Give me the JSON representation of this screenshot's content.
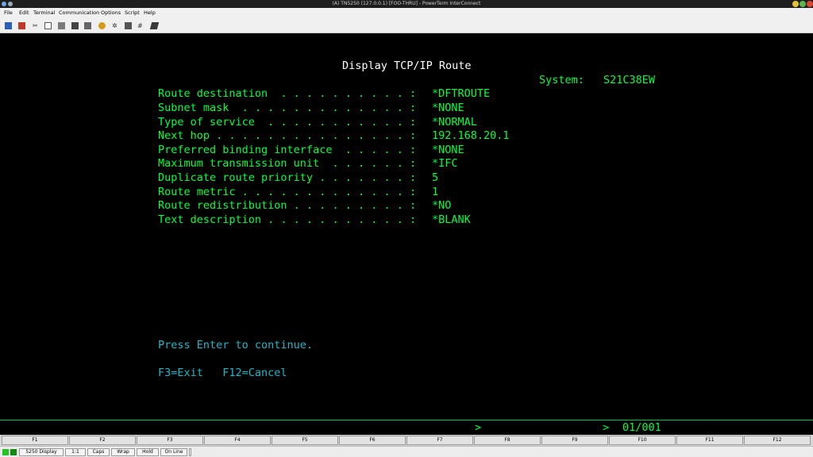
{
  "window": {
    "title": "(A) TN5250 (127.0.0.1) [FOO-THRU] - PowerTerm InterConnect"
  },
  "menu": [
    "File",
    "Edit",
    "Terminal",
    "Communication",
    "Options",
    "Script",
    "Help"
  ],
  "toolbar_icons": [
    "connect-icon",
    "disconnect-icon",
    "cut-icon",
    "copy-icon",
    "paste-icon",
    "print-icon",
    "print-screen-icon",
    "settings-icon",
    "macro-icon",
    "keyboard-icon",
    "grid-icon",
    "book-icon"
  ],
  "screen": {
    "title": "Display TCP/IP Route",
    "system_label": "System:",
    "system_value": "S21C38EW",
    "fields": [
      {
        "label": "Route destination  . . . . . . . . . . :",
        "value": "*DFTROUTE"
      },
      {
        "label": "Subnet mask  . . . . . . . . . . . . . :",
        "value": "*NONE"
      },
      {
        "label": "Type of service  . . . . . . . . . . . :",
        "value": "*NORMAL"
      },
      {
        "label": "Next hop . . . . . . . . . . . . . . . :",
        "value": "192.168.20.1"
      },
      {
        "label": "Preferred binding interface  . . . . . :",
        "value": "*NONE"
      },
      {
        "label": "Maximum transmission unit  . . . . . . :",
        "value": "*IFC"
      },
      {
        "label": "Duplicate route priority . . . . . . . :",
        "value": "5"
      },
      {
        "label": "Route metric . . . . . . . . . . . . . :",
        "value": "1"
      },
      {
        "label": "Route redistribution . . . . . . . . . :",
        "value": "*NO"
      },
      {
        "label": "Text description . . . . . . . . . . . :",
        "value": "*BLANK"
      }
    ],
    "press_enter": "Press Enter to continue.",
    "function_keys": "F3=Exit   F12=Cancel",
    "status_arrow1": ">",
    "status_arrow2": ">",
    "page_indicator": "01/001"
  },
  "fkeys": [
    "F1",
    "F2",
    "F3",
    "F4",
    "F5",
    "F6",
    "F7",
    "F8",
    "F9",
    "F10",
    "F11",
    "F12"
  ],
  "statusbar": {
    "display": "5250 Display",
    "ratio": "1:1",
    "caps": "Caps",
    "wrap": "Wrap",
    "hold": "Hold",
    "online": "On Line"
  },
  "colors": {
    "terminal_green": "#00ff3c",
    "terminal_white": "#ffffff",
    "terminal_cyan": "#1fb7c7"
  }
}
